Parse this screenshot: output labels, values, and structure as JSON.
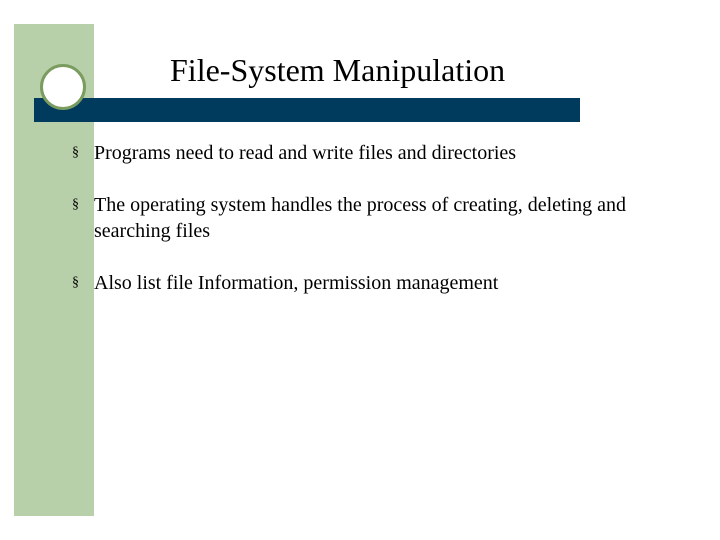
{
  "slide": {
    "title": "File-System Manipulation",
    "bullets": [
      {
        "marker": "§",
        "text": "Programs need to read and write files and directories"
      },
      {
        "marker": "§",
        "text": "The operating system handles the process of creating, deleting and searching files"
      },
      {
        "marker": "§",
        "text": "Also list file Information, permission management"
      }
    ]
  },
  "colors": {
    "sidebar": "#b8d0a9",
    "bar": "#003a5c",
    "circle": "#7a9c5f"
  }
}
